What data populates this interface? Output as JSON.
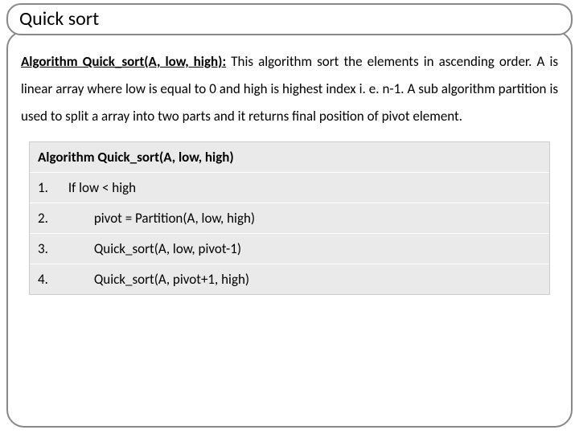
{
  "title": "Quick sort",
  "description": {
    "lead_bold": "Algorithm Quick_sort(A, low, high):",
    "body": " This algorithm sort the elements in ascending order. A is linear array where low is equal to 0 and high is highest index i. e. n-1. A sub algorithm partition is used to split a array into two parts and it returns final position of pivot element."
  },
  "algorithm": {
    "header": "Algorithm Quick_sort(A, low, high)",
    "steps": [
      {
        "num": "1.",
        "text": "If  low < high",
        "indent": 1
      },
      {
        "num": "2.",
        "text": "pivot = Partition(A, low, high)",
        "indent": 2
      },
      {
        "num": "3.",
        "text": "Quick_sort(A, low, pivot-1)",
        "indent": 2
      },
      {
        "num": "4.",
        "text": "Quick_sort(A, pivot+1, high)",
        "indent": 2
      }
    ]
  }
}
